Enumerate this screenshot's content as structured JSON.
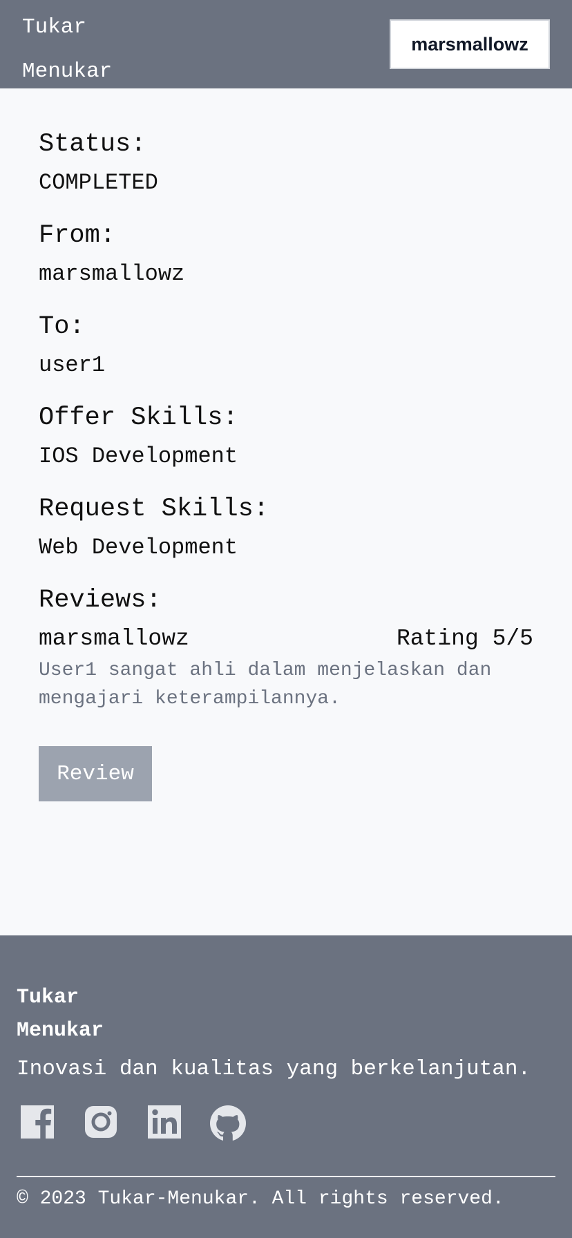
{
  "header": {
    "brand_line1": "Tukar",
    "brand_line2": "Menukar",
    "user_button": "marsmallowz"
  },
  "details": {
    "status_label": "Status:",
    "status_value": "COMPLETED",
    "from_label": "From:",
    "from_value": "marsmallowz",
    "to_label": "To:",
    "to_value": "user1",
    "offer_label": "Offer Skills:",
    "offer_value": "IOS Development",
    "request_label": "Request Skills:",
    "request_value": "Web Development"
  },
  "reviews": {
    "label": "Reviews:",
    "items": [
      {
        "author": "marsmallowz",
        "rating_text": "Rating 5/5",
        "text": "User1 sangat ahli dalam menjelaskan dan mengajari keterampilannya."
      }
    ],
    "button_label": "Review"
  },
  "footer": {
    "brand_line1": "Tukar",
    "brand_line2": "Menukar",
    "tagline": "Inovasi dan kualitas yang berkelanjutan.",
    "social_icons": [
      "facebook-icon",
      "instagram-icon",
      "linkedin-icon",
      "github-icon"
    ],
    "copyright": "© 2023 Tukar-Menukar. All rights reserved."
  },
  "colors": {
    "header_bg": "#6b7280",
    "page_bg": "#f8f9fb",
    "review_button_bg": "#9ca3af",
    "muted_text": "#6b7280",
    "icon_fill": "#e5e7eb"
  }
}
